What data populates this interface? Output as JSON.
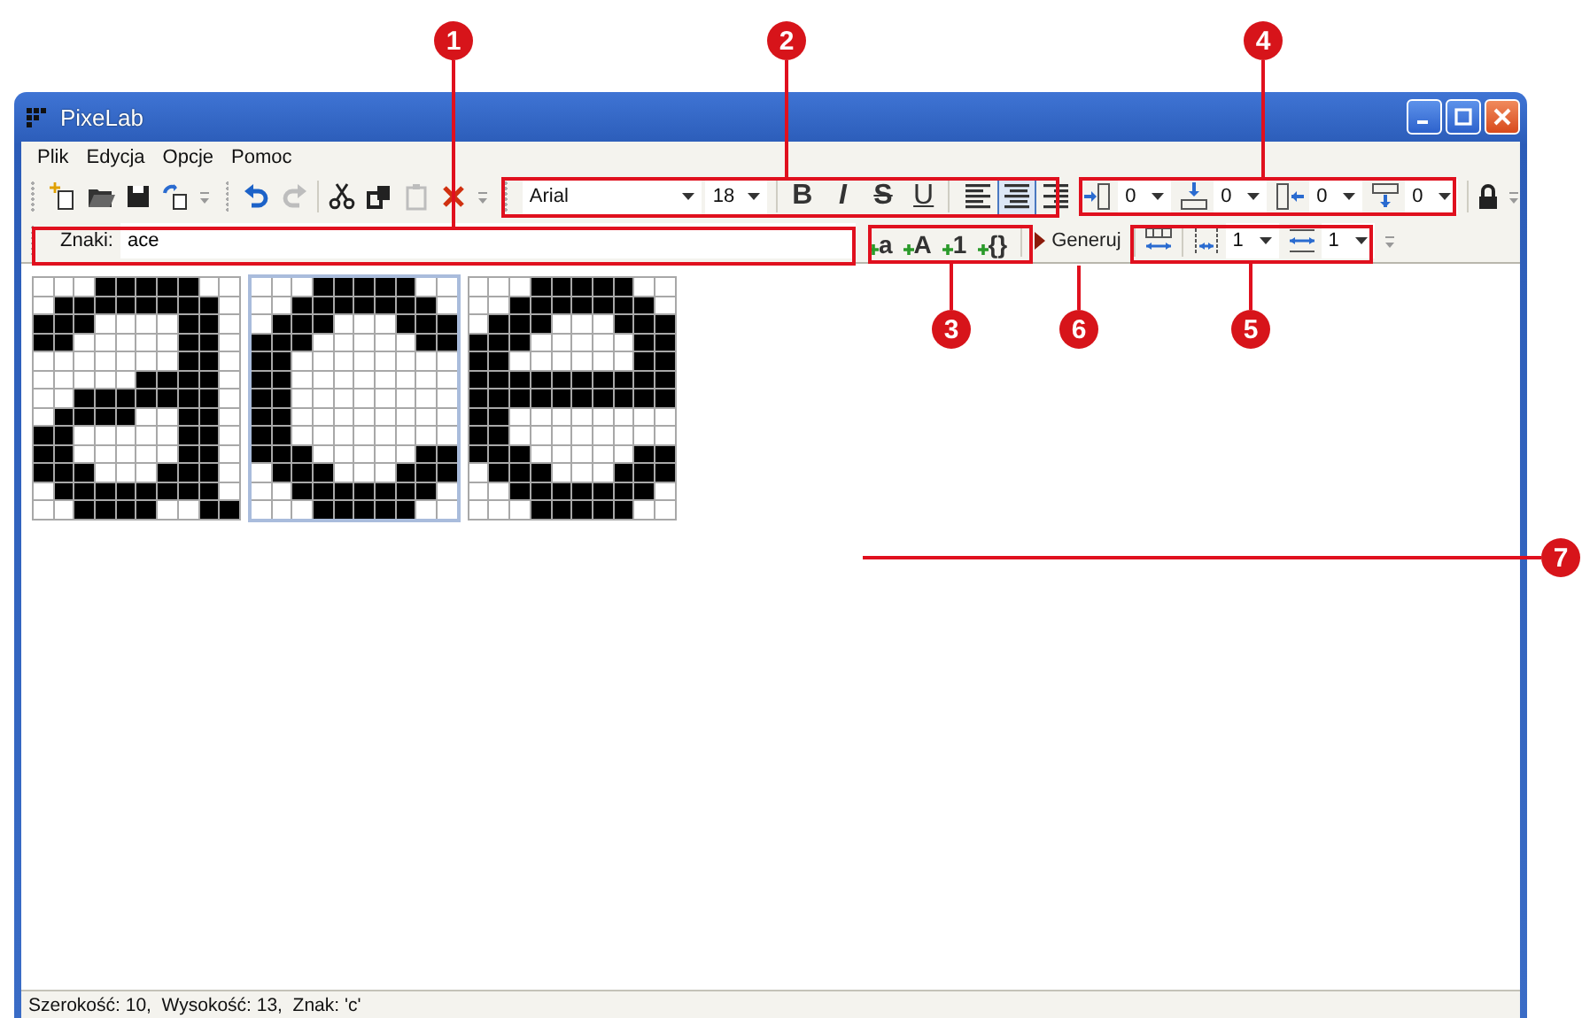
{
  "window": {
    "title": "PixeLab"
  },
  "menu": [
    "Plik",
    "Edycja",
    "Opcje",
    "Pomoc"
  ],
  "file_tools": [
    {
      "kind": "new"
    },
    {
      "kind": "open"
    },
    {
      "kind": "save"
    },
    {
      "kind": "paste-special"
    }
  ],
  "edit_tools": [
    {
      "kind": "undo",
      "disabled": false
    },
    {
      "kind": "redo",
      "disabled": true
    },
    {
      "kind": "cut",
      "disabled": false
    },
    {
      "kind": "copy",
      "disabled": false
    },
    {
      "kind": "paste",
      "disabled": true
    },
    {
      "kind": "delete",
      "disabled": false
    }
  ],
  "font": {
    "family": "Arial",
    "size": "18"
  },
  "format_buttons": [
    {
      "label": "B",
      "kind": "bold"
    },
    {
      "label": "I",
      "kind": "italic"
    },
    {
      "label": "S",
      "kind": "strike"
    },
    {
      "label": "U",
      "kind": "underline"
    }
  ],
  "alignment": [
    {
      "kind": "left",
      "selected": false
    },
    {
      "kind": "center",
      "selected": true
    },
    {
      "kind": "right",
      "selected": false
    }
  ],
  "spacing": [
    {
      "kind": "left",
      "value": "0"
    },
    {
      "kind": "top",
      "value": "0"
    },
    {
      "kind": "right",
      "value": "0"
    },
    {
      "kind": "bottom",
      "value": "0"
    }
  ],
  "chars_bar": {
    "label": "Znaki:",
    "value": "ace",
    "insert_buttons": [
      "a",
      "A",
      "1",
      "{}"
    ],
    "generate_button": "Generuj"
  },
  "layout_options": [
    {
      "kind": "fit-width"
    },
    {
      "kind": "char-spacing",
      "value": "1"
    },
    {
      "kind": "line-spacing",
      "value": "1"
    }
  ],
  "glyphs": [
    {
      "selected": false,
      "pixels": [
        [
          false,
          false,
          false,
          true,
          true,
          true,
          true,
          true,
          false,
          false
        ],
        [
          false,
          true,
          true,
          true,
          true,
          true,
          true,
          true,
          true,
          false
        ],
        [
          true,
          true,
          true,
          false,
          false,
          false,
          false,
          true,
          true,
          false
        ],
        [
          true,
          true,
          false,
          false,
          false,
          false,
          false,
          true,
          true,
          false
        ],
        [
          false,
          false,
          false,
          false,
          false,
          false,
          false,
          true,
          true,
          false
        ],
        [
          false,
          false,
          false,
          false,
          false,
          true,
          true,
          true,
          true,
          false
        ],
        [
          false,
          false,
          true,
          true,
          true,
          true,
          true,
          true,
          true,
          false
        ],
        [
          false,
          true,
          true,
          true,
          true,
          false,
          false,
          true,
          true,
          false
        ],
        [
          true,
          true,
          false,
          false,
          false,
          false,
          false,
          true,
          true,
          false
        ],
        [
          true,
          true,
          false,
          false,
          false,
          false,
          false,
          true,
          true,
          false
        ],
        [
          true,
          true,
          true,
          false,
          false,
          false,
          true,
          true,
          true,
          false
        ],
        [
          false,
          true,
          true,
          true,
          true,
          true,
          true,
          true,
          true,
          false
        ],
        [
          false,
          false,
          true,
          true,
          true,
          true,
          false,
          false,
          true,
          true
        ]
      ]
    },
    {
      "selected": true,
      "pixels": [
        [
          false,
          false,
          false,
          true,
          true,
          true,
          true,
          true,
          false,
          false
        ],
        [
          false,
          false,
          true,
          true,
          true,
          true,
          true,
          true,
          true,
          false
        ],
        [
          false,
          true,
          true,
          true,
          false,
          false,
          false,
          true,
          true,
          true
        ],
        [
          true,
          true,
          true,
          false,
          false,
          false,
          false,
          false,
          true,
          true
        ],
        [
          true,
          true,
          false,
          false,
          false,
          false,
          false,
          false,
          false,
          false
        ],
        [
          true,
          true,
          false,
          false,
          false,
          false,
          false,
          false,
          false,
          false
        ],
        [
          true,
          true,
          false,
          false,
          false,
          false,
          false,
          false,
          false,
          false
        ],
        [
          true,
          true,
          false,
          false,
          false,
          false,
          false,
          false,
          false,
          false
        ],
        [
          true,
          true,
          false,
          false,
          false,
          false,
          false,
          false,
          false,
          false
        ],
        [
          true,
          true,
          true,
          false,
          false,
          false,
          false,
          false,
          true,
          true
        ],
        [
          false,
          true,
          true,
          true,
          false,
          false,
          false,
          true,
          true,
          true
        ],
        [
          false,
          false,
          true,
          true,
          true,
          true,
          true,
          true,
          true,
          false
        ],
        [
          false,
          false,
          false,
          true,
          true,
          true,
          true,
          true,
          false,
          false
        ]
      ]
    },
    {
      "selected": false,
      "pixels": [
        [
          false,
          false,
          false,
          true,
          true,
          true,
          true,
          true,
          false,
          false
        ],
        [
          false,
          false,
          true,
          true,
          true,
          true,
          true,
          true,
          true,
          false
        ],
        [
          false,
          true,
          true,
          true,
          false,
          false,
          false,
          true,
          true,
          true
        ],
        [
          true,
          true,
          true,
          false,
          false,
          false,
          false,
          false,
          true,
          true
        ],
        [
          true,
          true,
          false,
          false,
          false,
          false,
          false,
          false,
          true,
          true
        ],
        [
          true,
          true,
          true,
          true,
          true,
          true,
          true,
          true,
          true,
          true
        ],
        [
          true,
          true,
          true,
          true,
          true,
          true,
          true,
          true,
          true,
          true
        ],
        [
          true,
          true,
          false,
          false,
          false,
          false,
          false,
          false,
          false,
          false
        ],
        [
          true,
          true,
          false,
          false,
          false,
          false,
          false,
          false,
          false,
          false
        ],
        [
          true,
          true,
          true,
          false,
          false,
          false,
          false,
          false,
          true,
          true
        ],
        [
          false,
          true,
          true,
          true,
          false,
          false,
          false,
          true,
          true,
          true
        ],
        [
          false,
          false,
          true,
          true,
          true,
          true,
          true,
          true,
          true,
          false
        ],
        [
          false,
          false,
          false,
          true,
          true,
          true,
          true,
          true,
          false,
          false
        ]
      ]
    }
  ],
  "status_bar": "Szerokość: 10,  Wysokość: 13,  Znak: 'c'",
  "callouts": [
    {
      "number": "1"
    },
    {
      "number": "2"
    },
    {
      "number": "4"
    },
    {
      "number": "3"
    },
    {
      "number": "6"
    },
    {
      "number": "5"
    },
    {
      "number": "7"
    }
  ]
}
